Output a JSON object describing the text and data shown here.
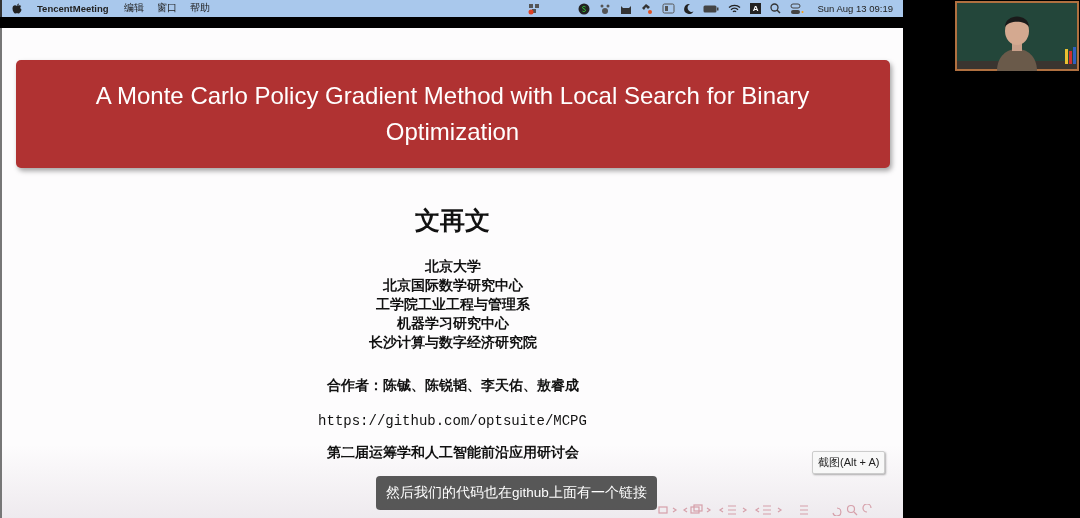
{
  "menu_bar": {
    "app_name": "TencentMeeting",
    "menus": [
      "编辑",
      "窗口",
      "帮助"
    ],
    "input_indicator": "A",
    "clock": "Sun Aug 13 09:19"
  },
  "slide": {
    "title": "A Monte Carlo Policy Gradient Method with Local Search for Binary Optimization",
    "author": "文再文",
    "affiliations": [
      "北京大学",
      "北京国际数学研究中心",
      "工学院工业工程与管理系",
      "机器学习研究中心",
      "长沙计算与数字经济研究院"
    ],
    "coauthors": "合作者：陈铖、陈锐韬、李天佑、敖睿成",
    "link": "https://github.com/optsuite/MCPG",
    "event": "第二届运筹学和人工智能前沿应用研讨会"
  },
  "subtitle": "然后我们的代码也在github上面有一个链接",
  "tooltip": "截图(Alt + A)"
}
